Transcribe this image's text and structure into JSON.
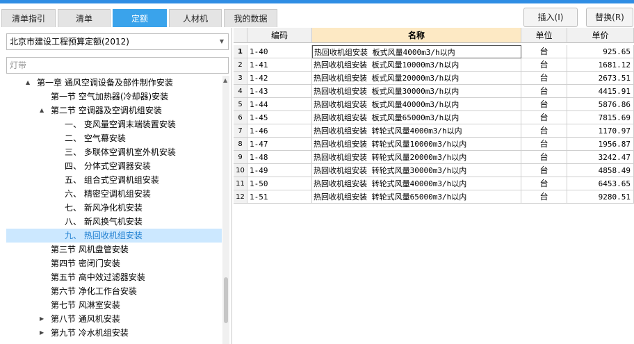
{
  "tabs": [
    {
      "label": "清单指引",
      "active": false
    },
    {
      "label": "清单",
      "active": false
    },
    {
      "label": "定额",
      "active": true
    },
    {
      "label": "人材机",
      "active": false
    },
    {
      "label": "我的数据",
      "active": false
    }
  ],
  "actions": {
    "insert_label": "插入(I)",
    "replace_label": "替换(R)"
  },
  "left": {
    "quota_library": "北京市建设工程预算定额(2012)",
    "search_value": "灯带"
  },
  "tree": [
    {
      "label": "第一章  通风空调设备及部件制作安装",
      "expander": "▲",
      "selected": false
    },
    {
      "label": "第一节  空气加热器(冷却器)安装",
      "expander": "",
      "selected": false
    },
    {
      "label": "第二节  空调器及空调机组安装",
      "expander": "▲",
      "selected": false
    },
    {
      "label": "一、  变风量空调末端装置安装",
      "expander": "",
      "selected": false
    },
    {
      "label": "二、  空气幕安装",
      "expander": "",
      "selected": false
    },
    {
      "label": "三、  多联体空调机室外机安装",
      "expander": "",
      "selected": false
    },
    {
      "label": "四、  分体式空调器安装",
      "expander": "",
      "selected": false
    },
    {
      "label": "五、  组合式空调机组安装",
      "expander": "",
      "selected": false
    },
    {
      "label": "六、  精密空调机组安装",
      "expander": "",
      "selected": false
    },
    {
      "label": "七、  新风净化机安装",
      "expander": "",
      "selected": false
    },
    {
      "label": "八、  新风换气机安装",
      "expander": "",
      "selected": false
    },
    {
      "label": "九、  热回收机组安装",
      "expander": "",
      "selected": true
    },
    {
      "label": "第三节  风机盘管安装",
      "expander": "",
      "selected": false
    },
    {
      "label": "第四节  密闭门安装",
      "expander": "",
      "selected": false
    },
    {
      "label": "第五节  高中效过滤器安装",
      "expander": "",
      "selected": false
    },
    {
      "label": "第六节  净化工作台安装",
      "expander": "",
      "selected": false
    },
    {
      "label": "第七节  风淋室安装",
      "expander": "",
      "selected": false
    },
    {
      "label": "第八节  通风机安装",
      "expander": "▶",
      "selected": false
    },
    {
      "label": "第九节  冷水机组安装",
      "expander": "▶",
      "selected": false
    }
  ],
  "table": {
    "headers": {
      "code": "编码",
      "name": "名称",
      "unit": "单位",
      "price": "单价"
    },
    "rows": [
      {
        "no": "1",
        "code": "1-40",
        "name": "热回收机组安装 板式风量4000m3/h以内",
        "unit": "台",
        "price": "925.65"
      },
      {
        "no": "2",
        "code": "1-41",
        "name": "热回收机组安装 板式风量10000m3/h以内",
        "unit": "台",
        "price": "1681.12"
      },
      {
        "no": "3",
        "code": "1-42",
        "name": "热回收机组安装 板式风量20000m3/h以内",
        "unit": "台",
        "price": "2673.51"
      },
      {
        "no": "4",
        "code": "1-43",
        "name": "热回收机组安装 板式风量30000m3/h以内",
        "unit": "台",
        "price": "4415.91"
      },
      {
        "no": "5",
        "code": "1-44",
        "name": "热回收机组安装 板式风量40000m3/h以内",
        "unit": "台",
        "price": "5876.86"
      },
      {
        "no": "6",
        "code": "1-45",
        "name": "热回收机组安装 板式风量65000m3/h以内",
        "unit": "台",
        "price": "7815.69"
      },
      {
        "no": "7",
        "code": "1-46",
        "name": "热回收机组安装 转轮式风量4000m3/h以内",
        "unit": "台",
        "price": "1170.97"
      },
      {
        "no": "8",
        "code": "1-47",
        "name": "热回收机组安装 转轮式风量10000m3/h以内",
        "unit": "台",
        "price": "1956.87"
      },
      {
        "no": "9",
        "code": "1-48",
        "name": "热回收机组安装 转轮式风量20000m3/h以内",
        "unit": "台",
        "price": "3242.47"
      },
      {
        "no": "10",
        "code": "1-49",
        "name": "热回收机组安装 转轮式风量30000m3/h以内",
        "unit": "台",
        "price": "4858.49"
      },
      {
        "no": "11",
        "code": "1-50",
        "name": "热回收机组安装 转轮式风量40000m3/h以内",
        "unit": "台",
        "price": "6453.65"
      },
      {
        "no": "12",
        "code": "1-51",
        "name": "热回收机组安装 转轮式风量65000m3/h以内",
        "unit": "台",
        "price": "9280.51"
      }
    ]
  },
  "colors": {
    "accent": "#3aa3eb",
    "header_highlight": "#fde9c4",
    "selection": "#cce8ff"
  }
}
